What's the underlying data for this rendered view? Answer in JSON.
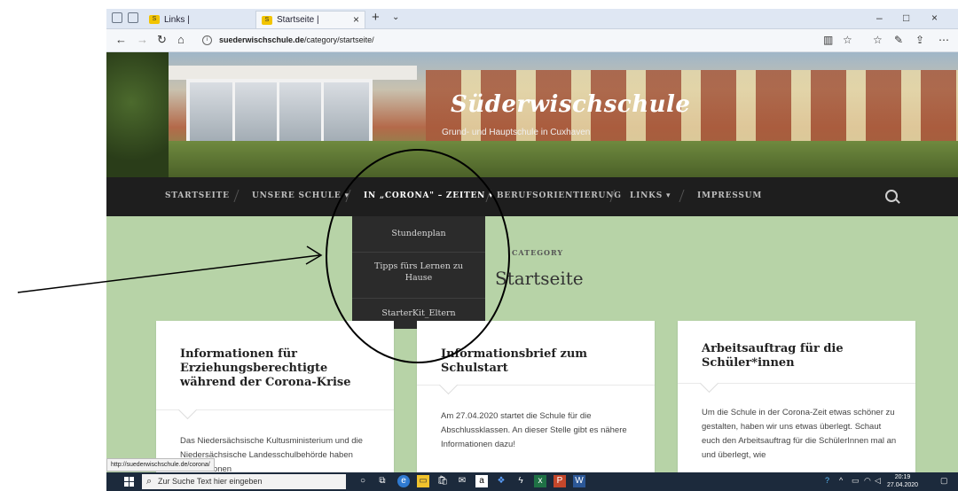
{
  "browser": {
    "tabs": [
      {
        "label": "Links |"
      },
      {
        "label": "Startseite |"
      }
    ],
    "new_tab": "+",
    "tab_menu": "⌄",
    "url_host": "suederwischschule.de",
    "url_path": "/category/startseite/",
    "window_min": "–",
    "window_max": "□",
    "window_close": "×"
  },
  "site": {
    "title": "Süderwischschule",
    "tagline": "Grund- und Hauptschule in Cuxhaven"
  },
  "nav": {
    "items": [
      {
        "label": "STARTSEITE"
      },
      {
        "label": "UNSERE SCHULE ▾"
      },
      {
        "label": "IN „CORONA\" – ZEITEN ▾"
      },
      {
        "label": "BERUFSORIENTIERUNG"
      },
      {
        "label": "LINKS ▾"
      },
      {
        "label": "IMPRESSUM"
      }
    ],
    "dropdown": [
      {
        "label": "Stundenplan"
      },
      {
        "label": "Tipps fürs Lernen zu Hause"
      },
      {
        "label": "StarterKit_Eltern"
      }
    ]
  },
  "category": {
    "label": "CATEGORY",
    "title": "Startseite"
  },
  "cards": [
    {
      "title": "Informationen für Erziehungsberechtigte während der Corona-Krise",
      "excerpt": "Das Niedersächsische Kultusministerium und die Niedersächsische Landesschulbehörde haben Informationen"
    },
    {
      "title": "Informationsbrief zum Schulstart",
      "excerpt": "Am 27.04.2020 startet die Schule für die Abschlussklassen. An dieser Stelle gibt es nähere Informationen dazu!"
    },
    {
      "title": "Arbeitsauftrag für die Schüler*innen",
      "excerpt": "Um die Schule in der Corona-Zeit etwas schöner zu gestalten, haben wir uns etwas überlegt.  Schaut euch den Arbeitsauftrag für die SchülerInnen mal an und überlegt, wie"
    }
  ],
  "status_url": "http://suederwischschule.de/corona/",
  "taskbar": {
    "search_placeholder": "Zur Suche Text hier eingeben",
    "time": "20:19",
    "date": "27.04.2020"
  },
  "colors": {
    "page_bg": "#b7d3a7",
    "nav_bg": "#1e1e1e",
    "dropdown_bg": "#2b2b2b",
    "annotation": "#000000"
  }
}
